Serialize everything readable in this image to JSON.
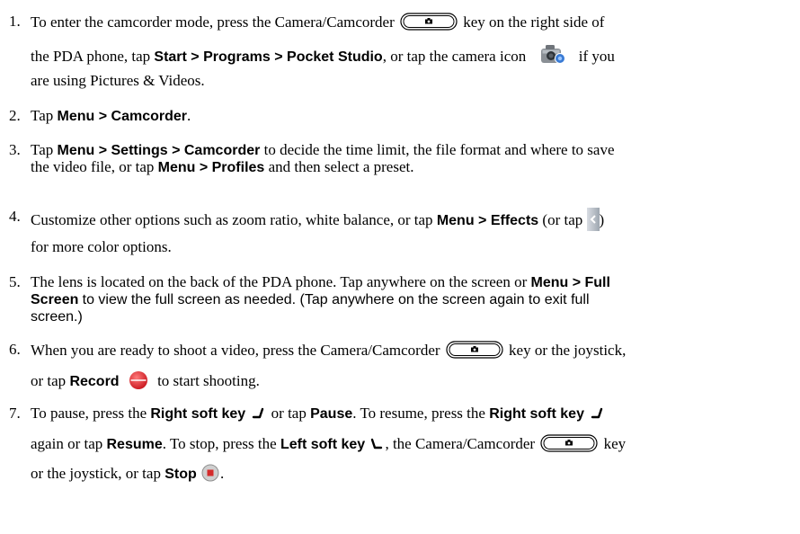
{
  "icons": {
    "camera_key": "camera-camcorder-key-icon",
    "camera_app": "camera-icon",
    "left_arrow": "left-arrow-icon",
    "record": "record-icon",
    "right_soft_key": "right-soft-key-icon",
    "left_soft_key": "left-soft-key-icon",
    "stop": "stop-icon"
  },
  "colors": {
    "record": "#e0242c",
    "stop_bg": "#c8c8c8",
    "stop_mark": "#d42a2a",
    "camera_body": "#8a8f95",
    "camera_accent": "#3a7bd5"
  },
  "steps": [
    {
      "num": "1.",
      "l1a": "To enter the camcorder mode, press the Camera/Camcorder",
      "l1b": "key on the right side of",
      "l2a": "the PDA phone, tap",
      "l2b": "Start > Programs > Pocket Studio",
      "l2c": ", or tap the camera icon",
      "l2d": "if you",
      "l3": "are using Pictures & Videos."
    },
    {
      "num": "2.",
      "a": "Tap",
      "b": "Menu > Camcorder",
      "c": "."
    },
    {
      "num": "3.",
      "a": "Tap",
      "b": "Menu > Settings > Camcorder",
      "c": "to decide the time limit, the file format and where to save",
      "d": "the video file, or tap",
      "e": "Menu > Profiles",
      "f": "and then select a preset."
    },
    {
      "num": "4.",
      "a": "Customize other options such as zoom ratio, white balance, or tap",
      "b": "Menu > Effects",
      "c": "(or tap",
      "d": ")",
      "e": "for more color options."
    },
    {
      "num": "5.",
      "a": "The lens is located on the back of the PDA phone. Tap anywhere on the screen or",
      "b": "Menu > Full",
      "c": "Screen",
      "d": "to view the full screen as needed. (Tap anywhere on the screen again to exit full",
      "e": "screen.)"
    },
    {
      "num": "6.",
      "a": "When you are ready to shoot a video, press the Camera/Camcorder",
      "b": "key or the joystick,",
      "c": "or tap",
      "d": "Record",
      "e": "to start shooting."
    },
    {
      "num": "7.",
      "a": "To pause, press the",
      "b": "Right soft key",
      "c": "or tap",
      "d": "Pause",
      "e": ". To resume, press the",
      "f": "Right soft key",
      "g": "again or tap",
      "h": "Resume",
      "i": ". To stop, press the",
      "j": "Left soft key",
      "k": ", the Camera/Camcorder",
      "l": "key",
      "m": "or the joystick, or tap",
      "n": "Stop",
      "o": "."
    }
  ]
}
